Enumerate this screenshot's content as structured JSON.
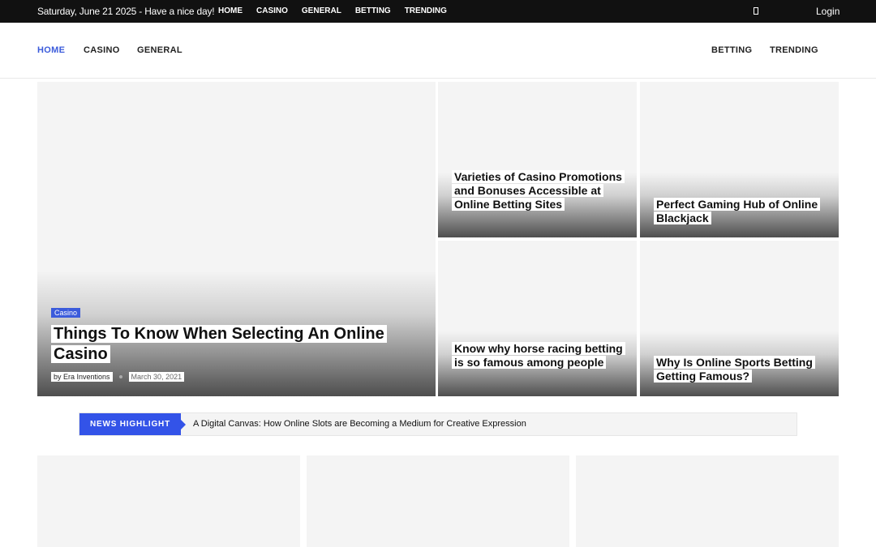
{
  "topbar": {
    "date_text": "Saturday, June 21 2025 - Have a nice day!",
    "links": [
      "HOME",
      "CASINO",
      "GENERAL",
      "BETTING",
      "TRENDING"
    ],
    "icon": "square-icon",
    "login_label": "Login"
  },
  "mainnav": {
    "home": "HOME",
    "casino": "CASINO",
    "general": "GENERAL",
    "betting": "BETTING",
    "trending": "TRENDING"
  },
  "featured": {
    "category": "Casino",
    "title": "Things To Know When Selecting An Online Casino",
    "author": "by Era Inventions",
    "date": "March 30, 2021"
  },
  "cards": [
    {
      "title": "Varieties of Casino Promotions and Bonuses Accessible at Online Betting Sites"
    },
    {
      "title": "Perfect Gaming Hub of Online Blackjack"
    },
    {
      "title": "Know why horse racing betting is so famous among people"
    },
    {
      "title": "Why Is Online Sports Betting Getting Famous?"
    }
  ],
  "news_highlight": {
    "label": "NEWS HIGHLIGHT",
    "headline": "A Digital Canvas: How Online Slots are Becoming a Medium for Creative Expression"
  },
  "colors": {
    "accent": "#3b5bdb",
    "topbar": "#111111",
    "card_bg": "#f4f4f4"
  }
}
